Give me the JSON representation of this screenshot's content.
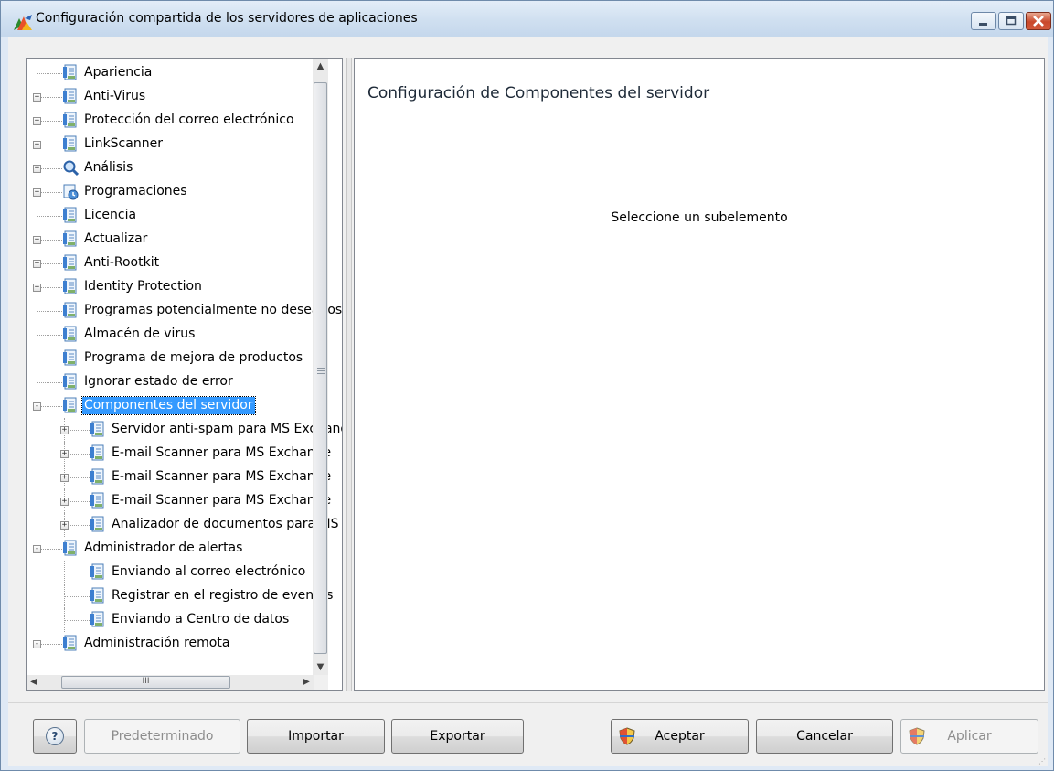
{
  "window": {
    "title": "Configuración compartida de los servidores de aplicaciones"
  },
  "tree": {
    "items": [
      {
        "label": "Apariencia",
        "icon": "settings-page-icon",
        "depth": 0,
        "expander": ""
      },
      {
        "label": "Anti-Virus",
        "icon": "settings-page-icon",
        "depth": 0,
        "expander": "+"
      },
      {
        "label": "Protección del correo electrónico",
        "icon": "settings-page-icon",
        "depth": 0,
        "expander": "+"
      },
      {
        "label": "LinkScanner",
        "icon": "settings-page-icon",
        "depth": 0,
        "expander": "+"
      },
      {
        "label": "Análisis",
        "icon": "magnifier-icon",
        "depth": 0,
        "expander": "+"
      },
      {
        "label": "Programaciones",
        "icon": "schedule-icon",
        "depth": 0,
        "expander": "+"
      },
      {
        "label": "Licencia",
        "icon": "settings-page-icon",
        "depth": 0,
        "expander": ""
      },
      {
        "label": "Actualizar",
        "icon": "settings-page-icon",
        "depth": 0,
        "expander": "+"
      },
      {
        "label": "Anti-Rootkit",
        "icon": "settings-page-icon",
        "depth": 0,
        "expander": "+"
      },
      {
        "label": "Identity Protection",
        "icon": "settings-page-icon",
        "depth": 0,
        "expander": "+"
      },
      {
        "label": "Programas potencialmente no deseados",
        "icon": "settings-page-icon",
        "depth": 0,
        "expander": ""
      },
      {
        "label": "Almacén de virus",
        "icon": "settings-page-icon",
        "depth": 0,
        "expander": ""
      },
      {
        "label": "Programa de mejora de productos",
        "icon": "settings-page-icon",
        "depth": 0,
        "expander": ""
      },
      {
        "label": "Ignorar estado de error",
        "icon": "settings-page-icon",
        "depth": 0,
        "expander": ""
      },
      {
        "label": "Componentes del servidor",
        "icon": "settings-page-icon",
        "depth": 0,
        "expander": "-",
        "selected": true
      },
      {
        "label": "Servidor anti-spam para MS Exchange",
        "icon": "settings-page-icon",
        "depth": 1,
        "expander": "+"
      },
      {
        "label": "E-mail Scanner para MS Exchange",
        "icon": "settings-page-icon",
        "depth": 1,
        "expander": "+"
      },
      {
        "label": "E-mail Scanner para MS Exchange",
        "icon": "settings-page-icon",
        "depth": 1,
        "expander": "+"
      },
      {
        "label": "E-mail Scanner para MS Exchange",
        "icon": "settings-page-icon",
        "depth": 1,
        "expander": "+"
      },
      {
        "label": "Analizador de documentos para MS SharePoint",
        "icon": "settings-page-icon",
        "depth": 1,
        "expander": "+"
      },
      {
        "label": "Administrador de alertas",
        "icon": "settings-page-icon",
        "depth": 0,
        "expander": "-"
      },
      {
        "label": "Enviando al correo electrónico",
        "icon": "settings-page-icon",
        "depth": 1,
        "expander": ""
      },
      {
        "label": "Registrar en el registro de eventos",
        "icon": "settings-page-icon",
        "depth": 1,
        "expander": ""
      },
      {
        "label": "Enviando a Centro de datos",
        "icon": "settings-page-icon",
        "depth": 1,
        "expander": ""
      },
      {
        "label": "Administración remota",
        "icon": "settings-page-icon",
        "depth": 0,
        "expander": "-"
      }
    ],
    "hscroll_grip": "III"
  },
  "content": {
    "title": "Configuración de Componentes del servidor",
    "message": "Seleccione un subelemento"
  },
  "buttons": {
    "help": "?",
    "default": "Predeterminado",
    "import": "Importar",
    "export": "Exportar",
    "accept": "Aceptar",
    "cancel": "Cancelar",
    "apply": "Aplicar"
  },
  "colors": {
    "selection": "#3399ff",
    "title_bar": "#cfdff0",
    "window_border": "#6f8bab"
  }
}
